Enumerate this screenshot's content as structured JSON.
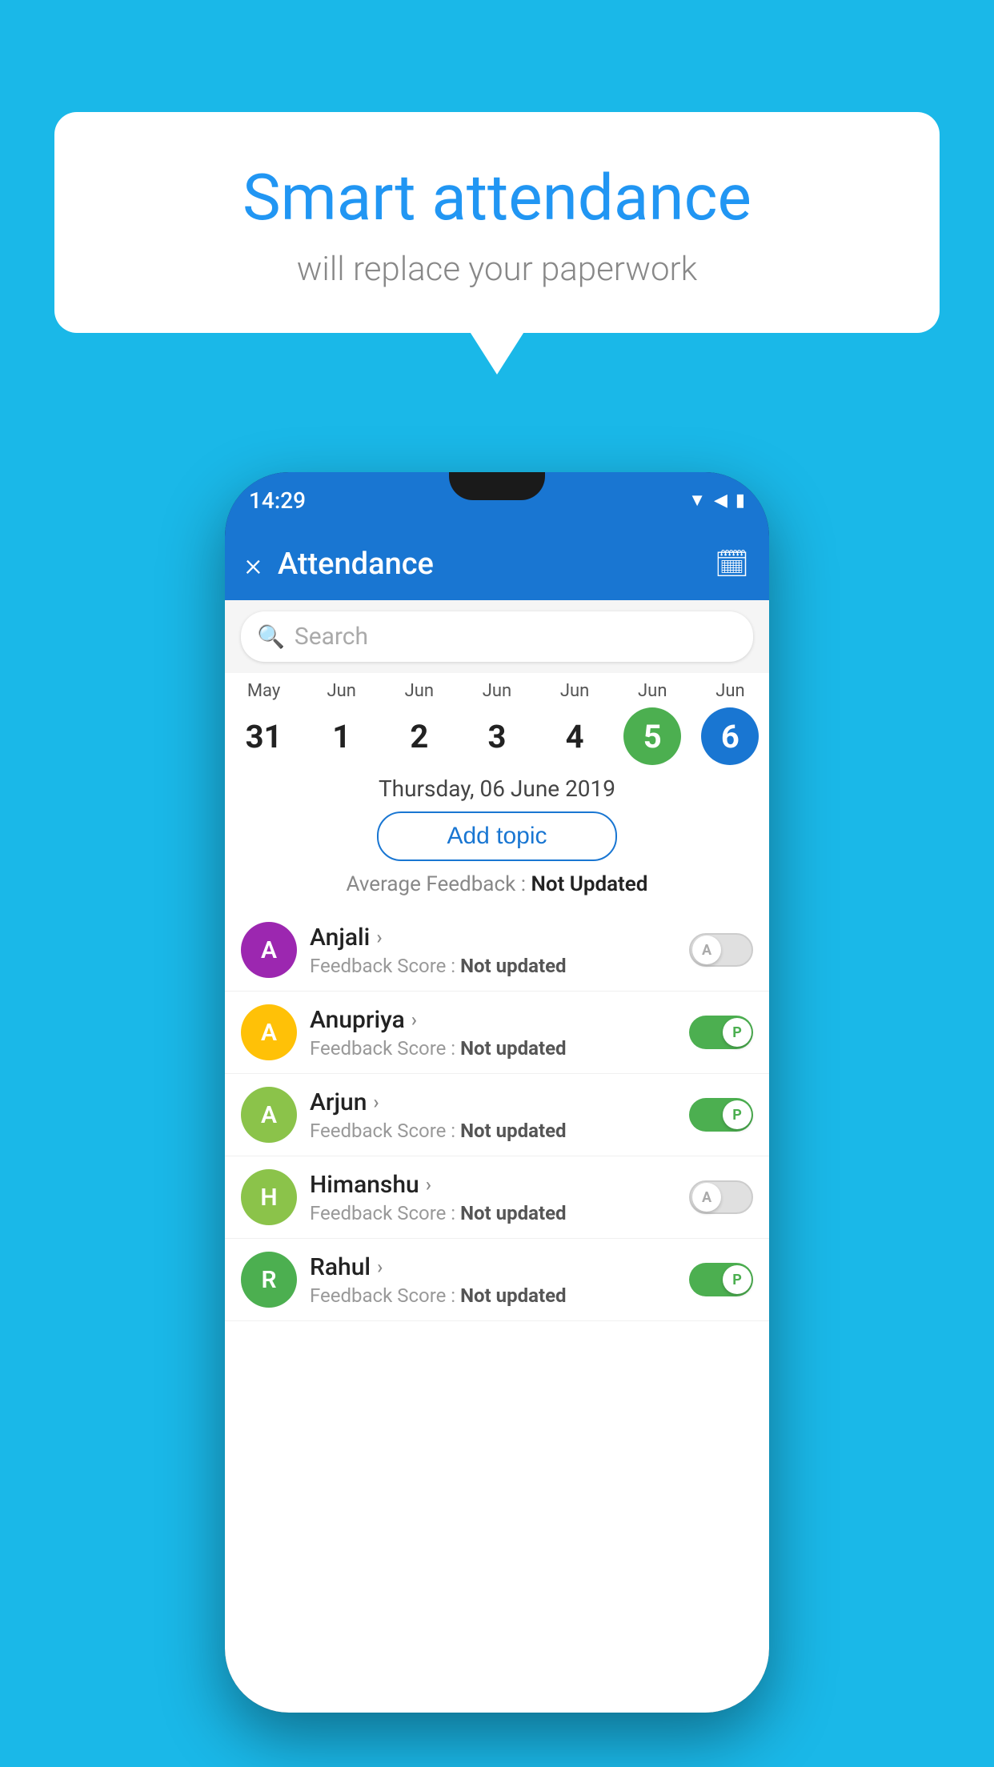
{
  "background_color": "#1ab8e8",
  "speech_bubble": {
    "title": "Smart attendance",
    "subtitle": "will replace your paperwork"
  },
  "phone": {
    "status_bar": {
      "time": "14:29",
      "icons": "▼◀▮"
    },
    "app_bar": {
      "close_label": "×",
      "title": "Attendance",
      "calendar_icon": "📅"
    },
    "search": {
      "placeholder": "Search"
    },
    "calendar": {
      "days": [
        {
          "month": "May",
          "date": "31",
          "state": "normal"
        },
        {
          "month": "Jun",
          "date": "1",
          "state": "normal"
        },
        {
          "month": "Jun",
          "date": "2",
          "state": "normal"
        },
        {
          "month": "Jun",
          "date": "3",
          "state": "normal"
        },
        {
          "month": "Jun",
          "date": "4",
          "state": "normal"
        },
        {
          "month": "Jun",
          "date": "5",
          "state": "today"
        },
        {
          "month": "Jun",
          "date": "6",
          "state": "selected"
        }
      ]
    },
    "selected_date_label": "Thursday, 06 June 2019",
    "add_topic_label": "Add topic",
    "avg_feedback_label": "Average Feedback :",
    "avg_feedback_value": "Not Updated",
    "students": [
      {
        "name": "Anjali",
        "avatar_letter": "A",
        "avatar_color": "#9c27b0",
        "feedback_label": "Feedback Score :",
        "feedback_value": "Not updated",
        "toggle": "off",
        "toggle_letter": "A"
      },
      {
        "name": "Anupriya",
        "avatar_letter": "A",
        "avatar_color": "#ffc107",
        "feedback_label": "Feedback Score :",
        "feedback_value": "Not updated",
        "toggle": "on",
        "toggle_letter": "P"
      },
      {
        "name": "Arjun",
        "avatar_letter": "A",
        "avatar_color": "#8bc34a",
        "feedback_label": "Feedback Score :",
        "feedback_value": "Not updated",
        "toggle": "on",
        "toggle_letter": "P"
      },
      {
        "name": "Himanshu",
        "avatar_letter": "H",
        "avatar_color": "#8bc34a",
        "feedback_label": "Feedback Score :",
        "feedback_value": "Not updated",
        "toggle": "off",
        "toggle_letter": "A"
      },
      {
        "name": "Rahul",
        "avatar_letter": "R",
        "avatar_color": "#4caf50",
        "feedback_label": "Feedback Score :",
        "feedback_value": "Not updated",
        "toggle": "on",
        "toggle_letter": "P"
      }
    ]
  }
}
